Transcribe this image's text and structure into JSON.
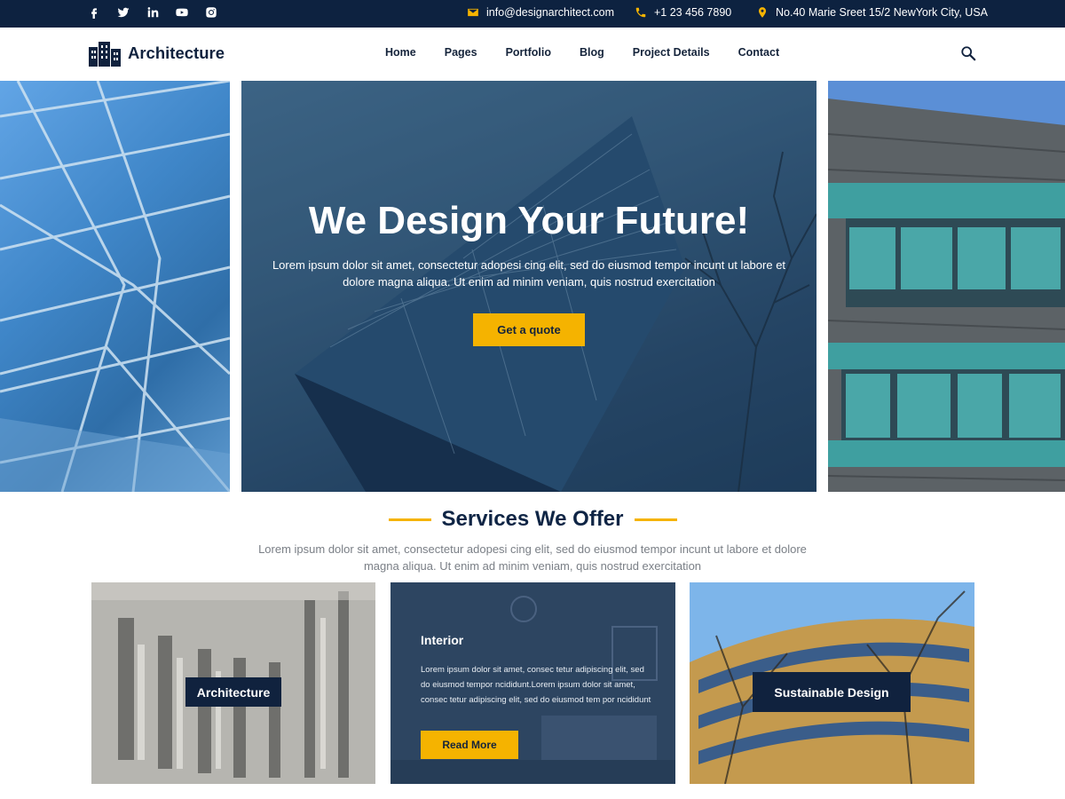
{
  "topbar": {
    "social": [
      "facebook-icon",
      "twitter-icon",
      "linkedin-icon",
      "youtube-icon",
      "instagram-icon"
    ],
    "email": "info@designarchitect.com",
    "phone": "+1 23 456 7890",
    "address": "No.40 Marie Sreet 15/2 NewYork City, USA"
  },
  "nav": {
    "logo_text": "Architecture",
    "items": [
      "Home",
      "Pages",
      "Portfolio",
      "Blog",
      "Project Details",
      "Contact"
    ]
  },
  "hero": {
    "title": "We Design Your Future!",
    "subtitle": "Lorem ipsum dolor sit amet, consectetur adopesi cing elit, sed do eiusmod tempor incunt ut labore et dolore magna aliqua. Ut enim ad minim veniam, quis nostrud exercitation",
    "button": "Get a quote"
  },
  "services": {
    "title": "Services We Offer",
    "subtitle": "Lorem ipsum dolor sit amet, consectetur adopesi cing elit, sed do eiusmod tempor incunt ut labore et dolore magna aliqua. Ut enim ad minim veniam, quis nostrud exercitation",
    "cards": [
      {
        "label": "Architecture"
      },
      {
        "title": "Interior",
        "text": "Lorem ipsum dolor sit amet, consec tetur adipiscing elit, sed do eiusmod tempor ncididunt.Lorem ipsum dolor sit amet, consec tetur adipiscing elit, sed do eiusmod tem por ncididunt",
        "button": "Read More"
      },
      {
        "label": "Sustainable Design"
      }
    ]
  },
  "colors": {
    "navy": "#0d2240",
    "accent": "#f5b300"
  }
}
